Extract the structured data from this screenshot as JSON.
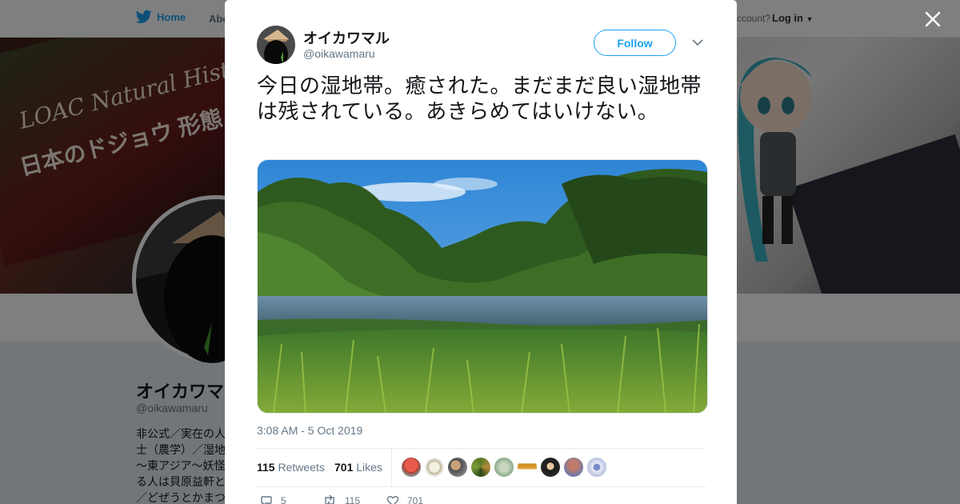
{
  "nav": {
    "home_label": "Home",
    "about_label": "Abo",
    "account_prompt": "ccount?",
    "login_label": "Log in"
  },
  "banner": {
    "book_title": "LOAC Natural History",
    "book_subtitle": "日本のドジョウ 形態・生態"
  },
  "profile": {
    "name": "オイカワマル",
    "handle": "@oikawamaru",
    "bio": "非公式／実在の人\n士（農学）／湿地\n～東アジア～妖怪\nる人は貝原益軒と\n／どぜうとかまつ"
  },
  "tweet": {
    "author_name": "オイカワマル",
    "author_handle": "@oikawamaru",
    "follow_label": "Follow",
    "text": "今日の湿地帯。癒された。まだまだ良い湿地帯は残されている。あきらめてはいけない。",
    "timestamp": "3:08 AM - 5 Oct 2019",
    "retweets_count": "115",
    "retweets_label": "Retweets",
    "likes_count": "701",
    "likes_label": "Likes",
    "actions": {
      "reply_count": "5",
      "retweet_count": "115",
      "like_count": "701"
    }
  },
  "colors": {
    "brand": "#1da1f2",
    "text": "#14171a",
    "secondary": "#657786"
  }
}
